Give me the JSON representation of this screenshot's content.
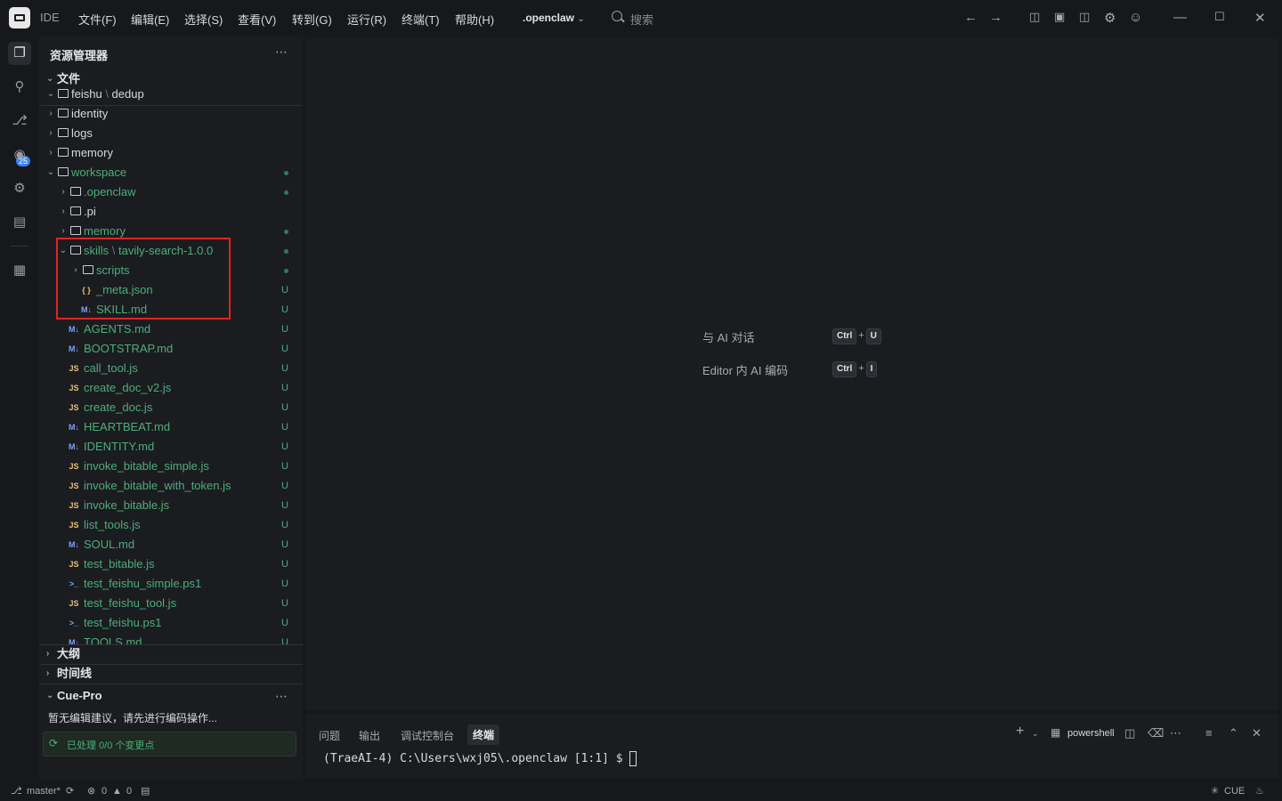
{
  "app": {
    "label": "IDE",
    "project": ".openclaw"
  },
  "menu": [
    "文件(F)",
    "编辑(E)",
    "选择(S)",
    "查看(V)",
    "转到(G)",
    "运行(R)",
    "终端(T)",
    "帮助(H)"
  ],
  "search": {
    "placeholder": "搜索"
  },
  "activity": {
    "scm_badge": "25"
  },
  "explorer": {
    "title": "资源管理器",
    "root_label": "文件",
    "rows": [
      {
        "label": "feishu",
        "label2": "dedup",
        "depth": 0,
        "open": true,
        "type": "folder",
        "status": "",
        "color": "#d7d9de"
      },
      {
        "label": "identity",
        "depth": 0,
        "open": false,
        "type": "folder",
        "status": "",
        "color": "#d7d9de"
      },
      {
        "label": "logs",
        "depth": 0,
        "open": false,
        "type": "folder",
        "status": "",
        "color": "#d7d9de"
      },
      {
        "label": "memory",
        "depth": 0,
        "open": false,
        "type": "folder",
        "status": "",
        "color": "#d7d9de"
      },
      {
        "label": "workspace",
        "depth": 0,
        "open": true,
        "type": "folder",
        "status": "dot",
        "color": "#4caf7a"
      },
      {
        "label": ".openclaw",
        "depth": 1,
        "open": false,
        "type": "folder",
        "status": "dot",
        "color": "#4caf7a"
      },
      {
        "label": ".pi",
        "depth": 1,
        "open": false,
        "type": "folder",
        "status": "",
        "color": "#d7d9de"
      },
      {
        "label": "memory",
        "depth": 1,
        "open": false,
        "type": "folder",
        "status": "dot",
        "color": "#4caf7a"
      },
      {
        "label": "skills",
        "label2": "tavily-search-1.0.0",
        "depth": 1,
        "open": true,
        "type": "folder",
        "status": "dot",
        "color": "#4caf7a"
      },
      {
        "label": "scripts",
        "depth": 2,
        "open": false,
        "type": "folder",
        "status": "dot",
        "color": "#4caf7a"
      },
      {
        "label": "_meta.json",
        "depth": 2,
        "type": "json",
        "status": "U",
        "color": "#4caf7a"
      },
      {
        "label": "SKILL.md",
        "depth": 2,
        "type": "md",
        "status": "U",
        "color": "#4caf7a"
      },
      {
        "label": "AGENTS.md",
        "depth": 1,
        "type": "md",
        "status": "U",
        "color": "#4caf7a"
      },
      {
        "label": "BOOTSTRAP.md",
        "depth": 1,
        "type": "md",
        "status": "U",
        "color": "#4caf7a"
      },
      {
        "label": "call_tool.js",
        "depth": 1,
        "type": "js",
        "status": "U",
        "color": "#4caf7a"
      },
      {
        "label": "create_doc_v2.js",
        "depth": 1,
        "type": "js",
        "status": "U",
        "color": "#4caf7a"
      },
      {
        "label": "create_doc.js",
        "depth": 1,
        "type": "js",
        "status": "U",
        "color": "#4caf7a"
      },
      {
        "label": "HEARTBEAT.md",
        "depth": 1,
        "type": "md",
        "status": "U",
        "color": "#4caf7a"
      },
      {
        "label": "IDENTITY.md",
        "depth": 1,
        "type": "md",
        "status": "U",
        "color": "#4caf7a"
      },
      {
        "label": "invoke_bitable_simple.js",
        "depth": 1,
        "type": "js",
        "status": "U",
        "color": "#4caf7a"
      },
      {
        "label": "invoke_bitable_with_token.js",
        "depth": 1,
        "type": "js",
        "status": "U",
        "color": "#4caf7a"
      },
      {
        "label": "invoke_bitable.js",
        "depth": 1,
        "type": "js",
        "status": "U",
        "color": "#4caf7a"
      },
      {
        "label": "list_tools.js",
        "depth": 1,
        "type": "js",
        "status": "U",
        "color": "#4caf7a"
      },
      {
        "label": "SOUL.md",
        "depth": 1,
        "type": "md",
        "status": "U",
        "color": "#4caf7a"
      },
      {
        "label": "test_bitable.js",
        "depth": 1,
        "type": "js",
        "status": "U",
        "color": "#4caf7a"
      },
      {
        "label": "test_feishu_simple.ps1",
        "depth": 1,
        "type": "ps1",
        "status": "U",
        "color": "#4caf7a"
      },
      {
        "label": "test_feishu_tool.js",
        "depth": 1,
        "type": "js",
        "status": "U",
        "color": "#4caf7a"
      },
      {
        "label": "test_feishu.ps1",
        "depth": 1,
        "type": "ps1",
        "status": "U",
        "color": "#4caf7a"
      },
      {
        "label": "TOOLS.md",
        "depth": 1,
        "type": "md",
        "status": "U",
        "color": "#4caf7a"
      }
    ],
    "outline": "大纲",
    "timeline": "时间线",
    "cue": {
      "title": "Cue-Pro",
      "message": "暂无编辑建议，请先进行编码操作...",
      "processed": "已处理 0/0 个变更点"
    }
  },
  "editor": {
    "hints": [
      {
        "label": "与 AI 对话",
        "keys": [
          "Ctrl",
          "U"
        ]
      },
      {
        "label": "Editor 内 AI 编码",
        "keys": [
          "Ctrl",
          "I"
        ]
      }
    ]
  },
  "panel": {
    "tabs": [
      "问题",
      "输出",
      "调试控制台",
      "终端"
    ],
    "active_tab": 3,
    "shell": "powershell",
    "prompt": "(TraeAI-4) C:\\Users\\wxj05\\.openclaw [1:1] $ "
  },
  "status": {
    "branch": "master*",
    "errors": "0",
    "warnings": "0",
    "cue": "CUE"
  }
}
